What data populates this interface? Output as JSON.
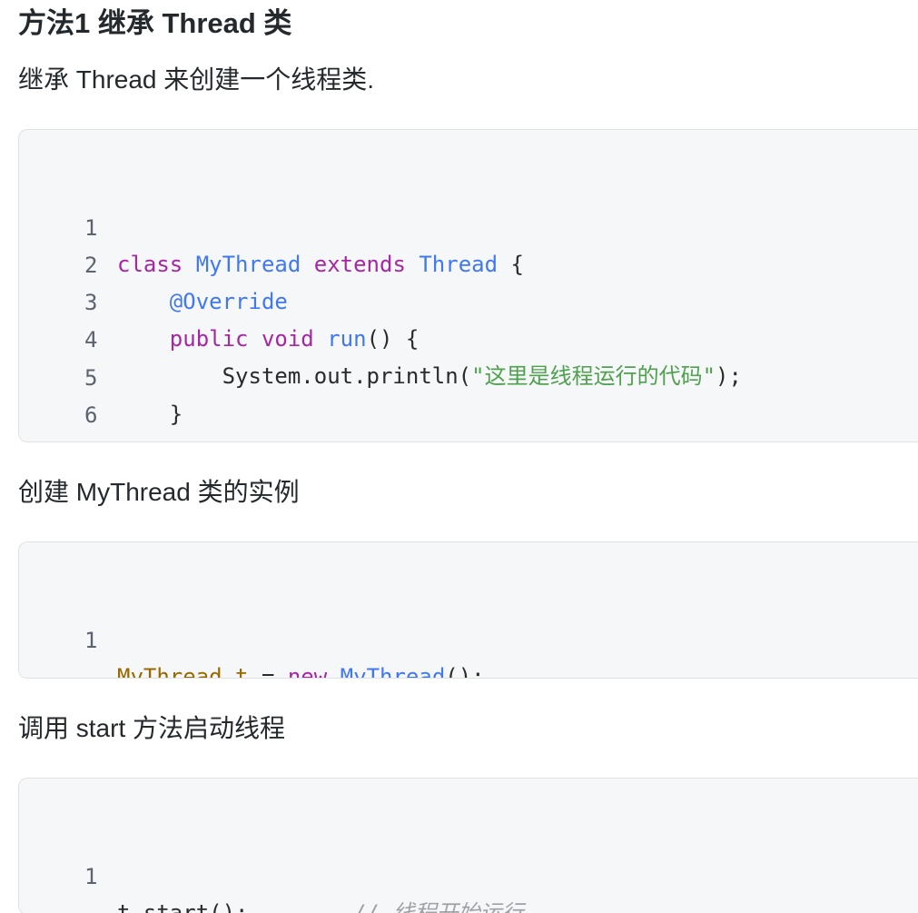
{
  "section": {
    "title": "方法1 继承 Thread 类",
    "intro": "继承 Thread 来创建一个线程类.",
    "step2_text": "创建 MyThread 类的实例",
    "step3_text": "调用 start 方法启动线程"
  },
  "code_block_1": {
    "line_numbers": [
      "1",
      "2",
      "3",
      "4",
      "5",
      "6"
    ],
    "lines": [
      {
        "kw": "class",
        "sp1": " ",
        "ty": "MyThread",
        "sp2": " ",
        "kw2": "extends",
        "sp3": " ",
        "ty2": "Thread",
        "rest": " {"
      },
      {
        "indent": "    ",
        "annotation": "@Override"
      },
      {
        "indent": "    ",
        "kw": "public",
        "sp1": " ",
        "kw2": "void",
        "sp2": " ",
        "fn": "run",
        "rest": "() {"
      },
      {
        "indent": "        ",
        "pre": "System.out.println(",
        "str": "\"这里是线程运行的代码\"",
        "rest": ");"
      },
      {
        "indent": "    ",
        "rest": "}"
      },
      {
        "rest": "}"
      }
    ]
  },
  "code_block_2": {
    "line_numbers": [
      "1"
    ],
    "lines": [
      {
        "cls": "MyThread",
        "var": " t",
        "op": " = ",
        "kw": "new",
        "sp": " ",
        "ty": "MyThread",
        "rest": "();"
      }
    ]
  },
  "code_block_3": {
    "line_numbers": [
      "1"
    ],
    "lines": [
      {
        "code": "t.start();",
        "pad": "        ",
        "comment": "// 线程开始运行"
      }
    ]
  }
}
